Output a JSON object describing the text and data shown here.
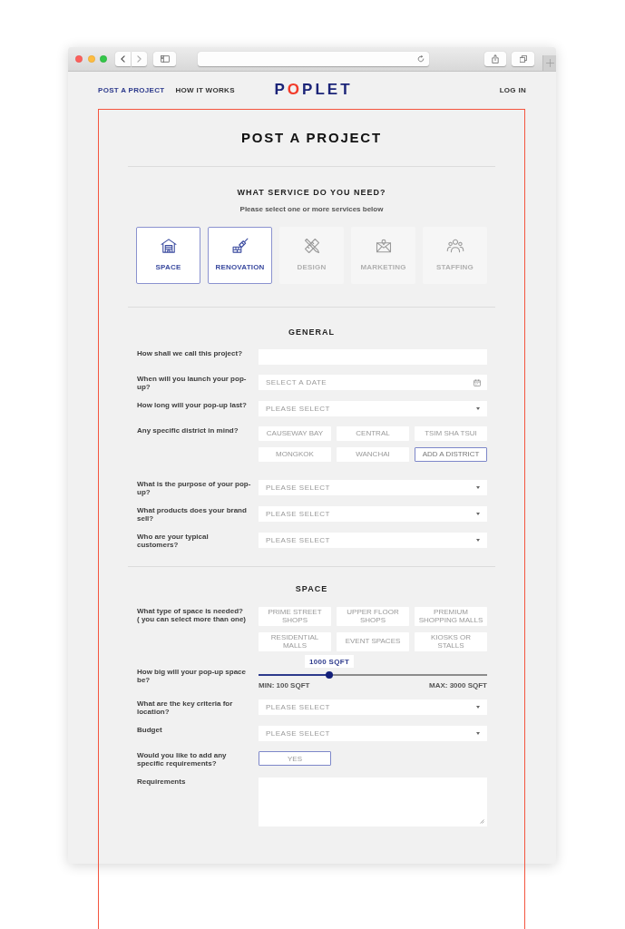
{
  "nav": {
    "links": [
      {
        "label": "POST A PROJECT",
        "selected": true
      },
      {
        "label": "HOW IT WORKS",
        "selected": false
      }
    ],
    "logo": "POPLET",
    "login": "LOG IN"
  },
  "title": "POST A PROJECT",
  "services": {
    "heading": "WHAT SERVICE DO YOU NEED?",
    "hint": "Please select one or more services below",
    "items": [
      {
        "label": "SPACE",
        "kind": "warehouse",
        "selected": true
      },
      {
        "label": "RENOVATION",
        "kind": "brush",
        "selected": true
      },
      {
        "label": "DESIGN",
        "kind": "pencil",
        "selected": false
      },
      {
        "label": "MARKETING",
        "kind": "letter",
        "selected": false
      },
      {
        "label": "STAFFING",
        "kind": "people",
        "selected": false
      }
    ]
  },
  "general": {
    "heading": "GENERAL",
    "rows": [
      {
        "kind": "text",
        "label": "How shall we call this project?"
      },
      {
        "kind": "date",
        "label": "When will you launch your pop-up?",
        "placeholder": "SELECT A DATE"
      },
      {
        "kind": "select",
        "label": "How long will your pop-up last?",
        "placeholder": "PLEASE SELECT"
      },
      {
        "kind": "chips",
        "label": "Any specific district in mind?",
        "options": [
          {
            "label": "CAUSEWAY BAY",
            "selected": false
          },
          {
            "label": "CENTRAL",
            "selected": false
          },
          {
            "label": "TSIM SHA TSUI",
            "selected": false
          },
          {
            "label": "MONGKOK",
            "selected": false
          },
          {
            "label": "WANCHAI",
            "selected": false
          }
        ],
        "add_button": "ADD A DISTRICT"
      },
      {
        "kind": "select",
        "label": "What is the purpose of your pop-up?",
        "placeholder": "PLEASE SELECT"
      },
      {
        "kind": "select",
        "label": "What products does your brand sell?",
        "placeholder": "PLEASE SELECT"
      },
      {
        "kind": "select",
        "label": "Who are your typical customers?",
        "placeholder": "PLEASE SELECT"
      }
    ]
  },
  "space": {
    "heading": "SPACE",
    "rows": [
      {
        "kind": "chips",
        "label": "What type of space is needed?",
        "note": "( you can select more than one)",
        "options": [
          {
            "label": "PRIME STREET SHOPS",
            "selected": false
          },
          {
            "label": "UPPER FLOOR SHOPS",
            "selected": false
          },
          {
            "label": "PREMIUM SHOPPING MALLS",
            "selected": false
          },
          {
            "label": "RESIDENTIAL MALLS",
            "selected": false
          },
          {
            "label": "EVENT SPACES",
            "selected": false
          },
          {
            "label": "KIOSKS OR STALLS",
            "selected": false
          }
        ]
      },
      {
        "kind": "slider",
        "label": "How big will your pop-up space be?",
        "level": 0.31,
        "value": "1000 SQFT",
        "min": "MIN: 100 SQFT",
        "max": "MAX: 3000 SQFT"
      },
      {
        "kind": "select",
        "label": "What are the key criteria for location?",
        "placeholder": "PLEASE SELECT"
      },
      {
        "kind": "select",
        "label": "Budget",
        "placeholder": "PLEASE SELECT"
      },
      {
        "kind": "toggle",
        "label": "Would you like to add any specific requirements?",
        "button": {
          "label": "YES",
          "selected": true
        }
      },
      {
        "kind": "textarea",
        "label": "Requirements"
      }
    ]
  }
}
